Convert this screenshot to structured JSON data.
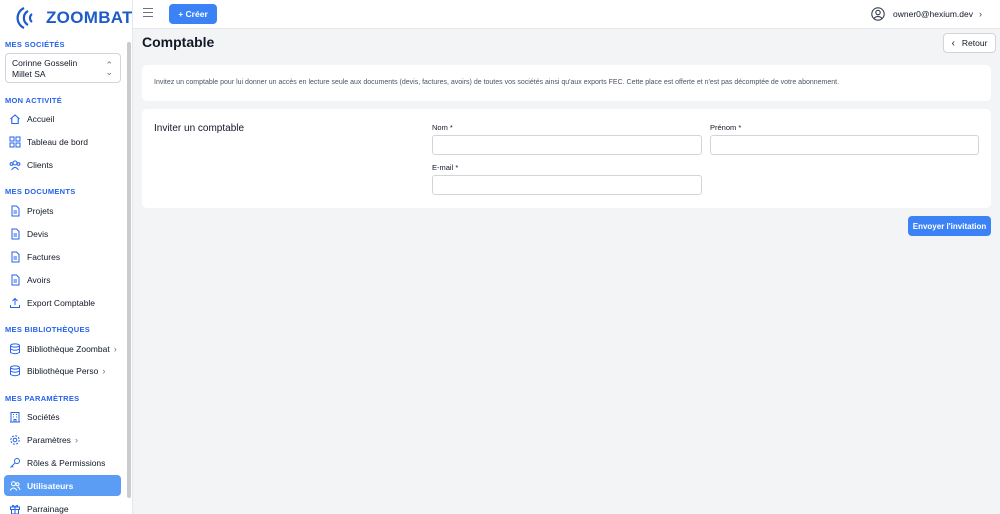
{
  "brand": {
    "name": "ZOOMBAT",
    "color": "#1e5bc6"
  },
  "sidebar": {
    "company_section": "MES SOCIÉTÉS",
    "company": {
      "name": "Corinne Gosselin",
      "subtitle": "Millet SA"
    },
    "sections": [
      {
        "title": "MON ACTIVITÉ",
        "items": [
          {
            "label": "Accueil",
            "icon": "home-icon"
          },
          {
            "label": "Tableau de bord",
            "icon": "dashboard-icon"
          },
          {
            "label": "Clients",
            "icon": "clients-icon"
          }
        ]
      },
      {
        "title": "MES DOCUMENTS",
        "items": [
          {
            "label": "Projets",
            "icon": "document-icon"
          },
          {
            "label": "Devis",
            "icon": "document-icon"
          },
          {
            "label": "Factures",
            "icon": "document-icon"
          },
          {
            "label": "Avoirs",
            "icon": "document-icon"
          },
          {
            "label": "Export Comptable",
            "icon": "upload-icon"
          }
        ]
      },
      {
        "title": "MES BIBLIOTHÈQUES",
        "items": [
          {
            "label": "Bibliothèque Zoombat",
            "icon": "database-icon",
            "arrow": "›"
          },
          {
            "label": "Bibliothèque Perso",
            "icon": "database-icon",
            "arrow": "›"
          }
        ]
      },
      {
        "title": "MES PARAMÈTRES",
        "items": [
          {
            "label": "Sociétés",
            "icon": "building-icon"
          },
          {
            "label": "Paramètres",
            "icon": "gear-icon",
            "arrow": "›"
          },
          {
            "label": "Rôles & Permissions",
            "icon": "key-icon"
          },
          {
            "label": "Utilisateurs",
            "icon": "users-icon",
            "active": true
          },
          {
            "label": "Parrainage",
            "icon": "gift-icon"
          }
        ]
      }
    ]
  },
  "topbar": {
    "create_label": "+ Créer",
    "user_email": "owner0@hexium.dev",
    "user_arrow": "›"
  },
  "page": {
    "title": "Comptable",
    "back_label": "Retour",
    "info": "Invitez un comptable pour lui donner un accès en lecture seule aux documents (devis, factures, avoirs) de toutes vos sociétés ainsi qu'aux exports FEC. Cette place est offerte et n'est pas décomptée de votre abonnement.",
    "form": {
      "title": "Inviter un comptable",
      "nom_label": "Nom *",
      "nom_value": "",
      "prenom_label": "Prénom *",
      "prenom_value": "",
      "email_label": "E-mail *",
      "email_value": ""
    },
    "submit_label": "Envoyer l'invitation"
  },
  "colors": {
    "accent": "#3b82f6",
    "active_nav": "#5b9cf5",
    "section_title": "#2563eb"
  }
}
